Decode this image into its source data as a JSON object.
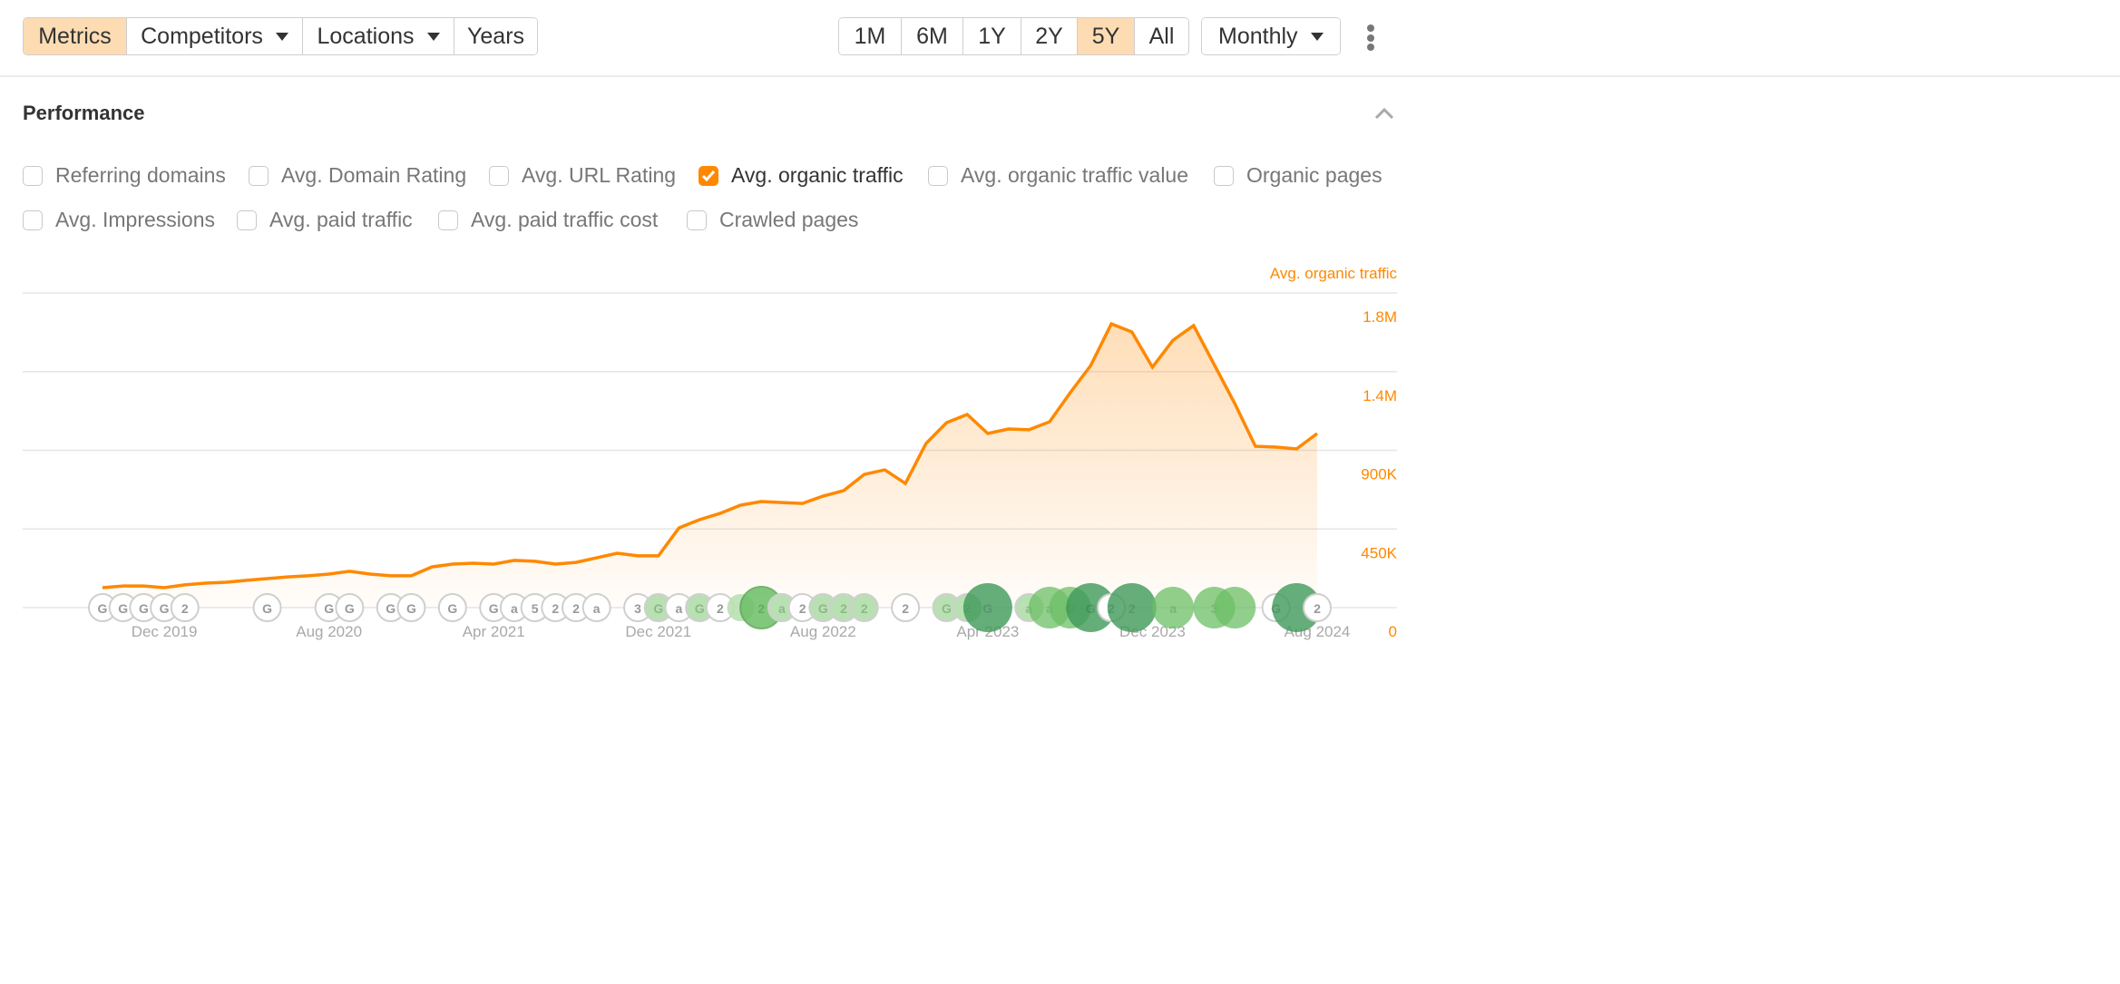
{
  "toolbar": {
    "left_group": [
      {
        "label": "Metrics",
        "active": true,
        "dropdown": false
      },
      {
        "label": "Competitors",
        "active": false,
        "dropdown": true
      },
      {
        "label": "Locations",
        "active": false,
        "dropdown": true
      },
      {
        "label": "Years",
        "active": false,
        "dropdown": false
      }
    ],
    "range_group": [
      {
        "label": "1M",
        "active": false
      },
      {
        "label": "6M",
        "active": false
      },
      {
        "label": "1Y",
        "active": false
      },
      {
        "label": "2Y",
        "active": false
      },
      {
        "label": "5Y",
        "active": true
      },
      {
        "label": "All",
        "active": false
      }
    ],
    "interval": {
      "label": "Monthly"
    },
    "more_icon": "kebab-menu-icon"
  },
  "section": {
    "title": "Performance",
    "collapse_icon": "chevron-up-icon"
  },
  "metrics": [
    {
      "label": "Referring domains",
      "checked": false
    },
    {
      "label": "Avg. Domain Rating",
      "checked": false
    },
    {
      "label": "Avg. URL Rating",
      "checked": false
    },
    {
      "label": "Avg. organic traffic",
      "checked": true
    },
    {
      "label": "Avg. organic traffic value",
      "checked": false
    },
    {
      "label": "Organic pages",
      "checked": false
    },
    {
      "label": "Avg. Impressions",
      "checked": false
    },
    {
      "label": "Avg. paid traffic",
      "checked": false
    },
    {
      "label": "Avg. paid traffic cost",
      "checked": false
    },
    {
      "label": "Crawled pages",
      "checked": false
    }
  ],
  "colors": {
    "accent": "#ff8800",
    "active_button_bg": "#fddcb3",
    "annotation_green_light": "#a8d8a0",
    "annotation_green_mid": "#6cbf66",
    "annotation_green_dark": "#3f9a5a"
  },
  "chart_data": {
    "type": "area",
    "title": "",
    "series": [
      {
        "name": "Avg. organic traffic",
        "color": "#ff8800",
        "start": "Sep 2019",
        "interval": "monthly",
        "values": [
          114000,
          124000,
          124000,
          114000,
          130000,
          140000,
          145000,
          156000,
          166000,
          176000,
          182000,
          192000,
          208000,
          192000,
          182000,
          182000,
          233000,
          249000,
          254000,
          249000,
          270000,
          265000,
          249000,
          259000,
          285000,
          311000,
          296000,
          296000,
          456000,
          503000,
          539000,
          586000,
          607000,
          601000,
          596000,
          638000,
          669000,
          762000,
          788000,
          710000,
          939000,
          1058000,
          1105000,
          996000,
          1022000,
          1017000,
          1063000,
          1229000,
          1385000,
          1623000,
          1577000,
          1375000,
          1530000,
          1613000,
          1390000,
          1167000,
          923000,
          918000,
          908000,
          996000
        ]
      }
    ],
    "x_tick_labels": [
      "Dec 2019",
      "Aug 2020",
      "Apr 2021",
      "Dec 2021",
      "Aug 2022",
      "Apr 2023",
      "Dec 2023",
      "Aug 2024"
    ],
    "y_tick_labels": [
      "0",
      "450K",
      "900K",
      "1.4M",
      "1.8M"
    ],
    "y_ticks": [
      0,
      450000,
      900000,
      1350000,
      1800000
    ],
    "ylim": [
      0,
      1800000
    ],
    "ylabel": "Avg. organic traffic",
    "y_axis_side": "right",
    "grid": true,
    "annotations": [
      {
        "month": 0,
        "label": "G",
        "style": "outline"
      },
      {
        "month": 1,
        "label": "G",
        "style": "outline"
      },
      {
        "month": 2,
        "label": "G",
        "style": "outline"
      },
      {
        "month": 3,
        "label": "G",
        "style": "outline"
      },
      {
        "month": 4,
        "label": "2",
        "style": "outline"
      },
      {
        "month": 8,
        "label": "G",
        "style": "outline"
      },
      {
        "month": 11,
        "label": "G",
        "style": "outline"
      },
      {
        "month": 12,
        "label": "G",
        "style": "outline"
      },
      {
        "month": 14,
        "label": "G",
        "style": "outline"
      },
      {
        "month": 15,
        "label": "G",
        "style": "outline"
      },
      {
        "month": 17,
        "label": "G",
        "style": "outline"
      },
      {
        "month": 19,
        "label": "G",
        "style": "outline"
      },
      {
        "month": 20,
        "label": "a",
        "style": "outline"
      },
      {
        "month": 21,
        "label": "5",
        "style": "outline"
      },
      {
        "month": 22,
        "label": "2",
        "style": "outline"
      },
      {
        "month": 23,
        "label": "2",
        "style": "outline"
      },
      {
        "month": 24,
        "label": "a",
        "style": "outline"
      },
      {
        "month": 26,
        "label": "3",
        "style": "outline"
      },
      {
        "month": 27,
        "label": "G",
        "style": "light"
      },
      {
        "month": 28,
        "label": "a",
        "style": "outline"
      },
      {
        "month": 29,
        "label": "G",
        "style": "light"
      },
      {
        "month": 30,
        "label": "2",
        "style": "outline"
      },
      {
        "month": 31,
        "label": "",
        "style": "light-small"
      },
      {
        "month": 32,
        "label": "2",
        "style": "mid-large"
      },
      {
        "month": 33,
        "label": "a",
        "style": "light"
      },
      {
        "month": 34,
        "label": "2",
        "style": "outline"
      },
      {
        "month": 35,
        "label": "G",
        "style": "light"
      },
      {
        "month": 36,
        "label": "2",
        "style": "light"
      },
      {
        "month": 37,
        "label": "2",
        "style": "light"
      },
      {
        "month": 39,
        "label": "2",
        "style": "outline"
      },
      {
        "month": 41,
        "label": "G",
        "style": "light"
      },
      {
        "month": 42,
        "label": "2",
        "style": "light"
      },
      {
        "month": 43,
        "label": "G",
        "style": "dark-large"
      },
      {
        "month": 45,
        "label": "a",
        "style": "light"
      },
      {
        "month": 46,
        "label": "a",
        "style": "mid"
      },
      {
        "month": 47,
        "label": "G",
        "style": "mid"
      },
      {
        "month": 48,
        "label": "G",
        "style": "dark-large"
      },
      {
        "month": 49,
        "label": "2",
        "style": "outline"
      },
      {
        "month": 50,
        "label": "2",
        "style": "dark-large"
      },
      {
        "month": 52,
        "label": "a",
        "style": "mid"
      },
      {
        "month": 54,
        "label": "3",
        "style": "mid"
      },
      {
        "month": 55,
        "label": "",
        "style": "mid"
      },
      {
        "month": 57,
        "label": "G",
        "style": "outline"
      },
      {
        "month": 58,
        "label": "",
        "style": "dark-large"
      },
      {
        "month": 59,
        "label": "2",
        "style": "outline"
      }
    ]
  }
}
